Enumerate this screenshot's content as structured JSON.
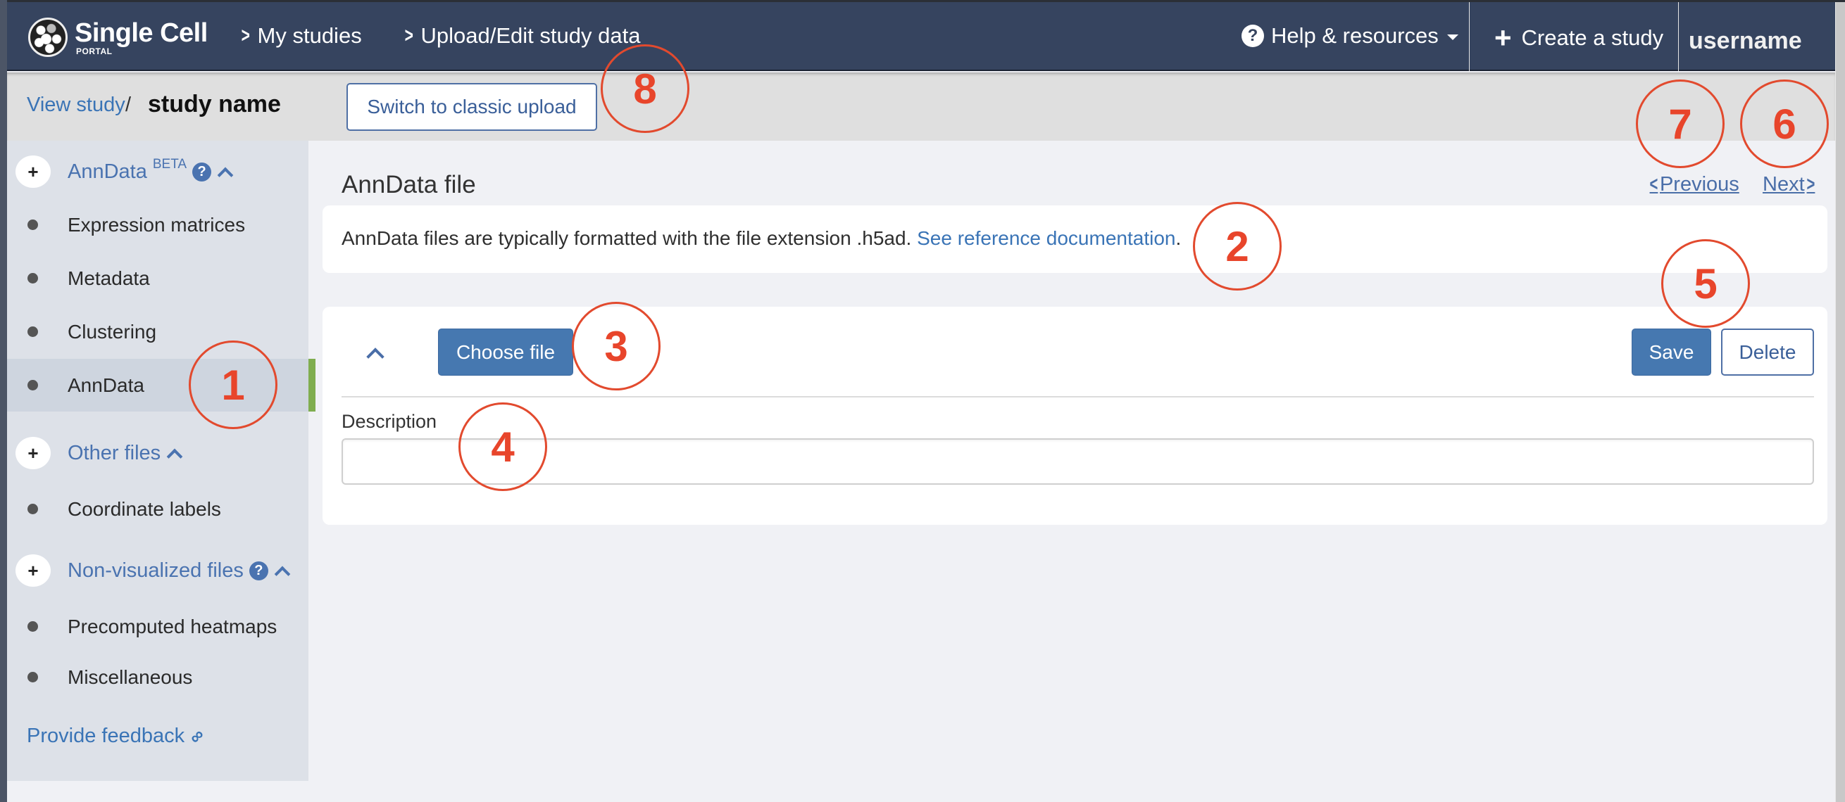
{
  "header": {
    "logo_main": "Single Cell",
    "logo_sub": "PORTAL",
    "nav": [
      {
        "label": "My studies",
        "icon": "chevron-right-icon"
      },
      {
        "label": "Upload/Edit study data",
        "icon": "chevron-right-icon"
      }
    ],
    "help_label": "Help & resources",
    "help_icon_glyph": "?",
    "create_label": "Create a study",
    "create_icon_glyph": "+",
    "username": "username"
  },
  "breadcrumb": {
    "view_study": "View study",
    "separator": "/",
    "study_name": "study name",
    "switch_button": "Switch to classic upload"
  },
  "sidebar": {
    "plus_glyph": "+",
    "help_glyph": "?",
    "sections": [
      {
        "title": "AnnData",
        "badge": "BETA",
        "has_help": true,
        "items": [
          "Expression matrices",
          "Metadata",
          "Clustering",
          "AnnData"
        ]
      },
      {
        "title": "Other files",
        "has_help": false,
        "items": [
          "Coordinate labels"
        ]
      },
      {
        "title": "Non-visualized files",
        "has_help": true,
        "items": [
          "Precomputed heatmaps",
          "Miscellaneous"
        ]
      }
    ],
    "active_item": "AnnData",
    "feedback_label": "Provide feedback",
    "feedback_icon_glyph": "🔗"
  },
  "main": {
    "title": "AnnData file",
    "previous_label": "Previous",
    "next_label": "Next",
    "info_text": "AnnData files are typically formatted with the file extension .h5ad.",
    "info_link": "See reference documentation",
    "info_end": ".",
    "choose_file_label": "Choose file",
    "save_label": "Save",
    "delete_label": "Delete",
    "description_label": "Description",
    "description_value": "",
    "description_placeholder": ""
  },
  "annotations": [
    "1",
    "2",
    "3",
    "4",
    "5",
    "6",
    "7",
    "8"
  ],
  "colors": {
    "header_bg": "#36445f",
    "accent_blue": "#4678b0",
    "link_blue": "#3a74b6",
    "active_indicator": "#7fad4f",
    "annotation_red": "#e8452b"
  }
}
